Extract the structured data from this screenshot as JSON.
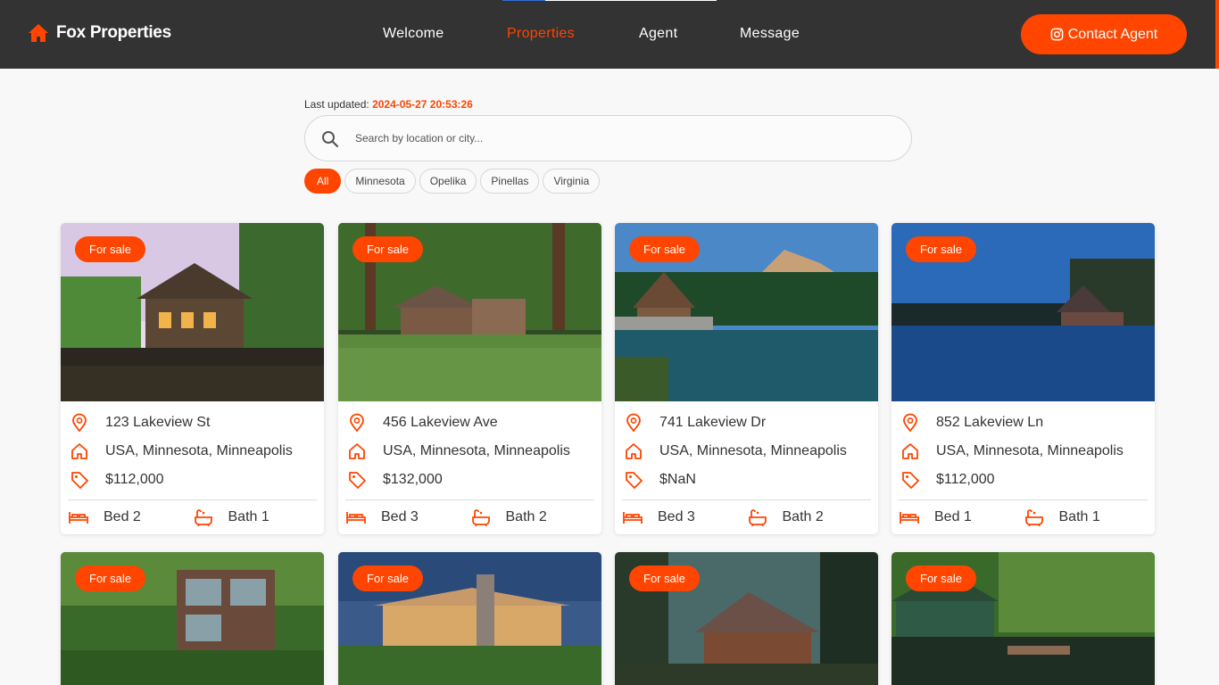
{
  "brand": {
    "name": "Fox Properties",
    "accent_color": "#ff4500",
    "header_bg": "#333333"
  },
  "nav": {
    "items": [
      {
        "label": "Welcome",
        "active": false
      },
      {
        "label": "Properties",
        "active": true
      },
      {
        "label": "Agent",
        "active": false
      },
      {
        "label": "Message",
        "active": false
      }
    ],
    "contact_label": "Contact Agent",
    "contact_icon": "instagram-icon"
  },
  "status": {
    "last_updated_label": "Last updated:",
    "last_updated_value": "2024-05-27 20:53:26"
  },
  "search": {
    "placeholder": "Search by location or city...",
    "value": ""
  },
  "filters": [
    {
      "label": "All",
      "active": true
    },
    {
      "label": "Minnesota",
      "active": false
    },
    {
      "label": "Opelika",
      "active": false
    },
    {
      "label": "Pinellas",
      "active": false
    },
    {
      "label": "Virginia",
      "active": false
    }
  ],
  "listings": [
    {
      "badge": "For sale",
      "address": "123 Lakeview St",
      "region": "USA, Minnesota, Minneapolis",
      "price": "$112,000",
      "bed": "Bed 2",
      "bath": "Bath 1"
    },
    {
      "badge": "For sale",
      "address": "456 Lakeview Ave",
      "region": "USA, Minnesota, Minneapolis",
      "price": "$132,000",
      "bed": "Bed 3",
      "bath": "Bath 2"
    },
    {
      "badge": "For sale",
      "address": "741 Lakeview Dr",
      "region": "USA, Minnesota, Minneapolis",
      "price": "$NaN",
      "bed": "Bed 3",
      "bath": "Bath 2"
    },
    {
      "badge": "For sale",
      "address": "852 Lakeview Ln",
      "region": "USA, Minnesota, Minneapolis",
      "price": "$112,000",
      "bed": "Bed 1",
      "bath": "Bath 1"
    },
    {
      "badge": "For sale"
    },
    {
      "badge": "For sale"
    },
    {
      "badge": "For sale"
    },
    {
      "badge": "For sale"
    }
  ],
  "icons": {
    "logo": "house-icon",
    "search": "search-icon",
    "address": "map-pin-icon",
    "region": "home-icon",
    "price": "price-tag-icon",
    "bed": "bed-icon",
    "bath": "bathtub-icon"
  }
}
